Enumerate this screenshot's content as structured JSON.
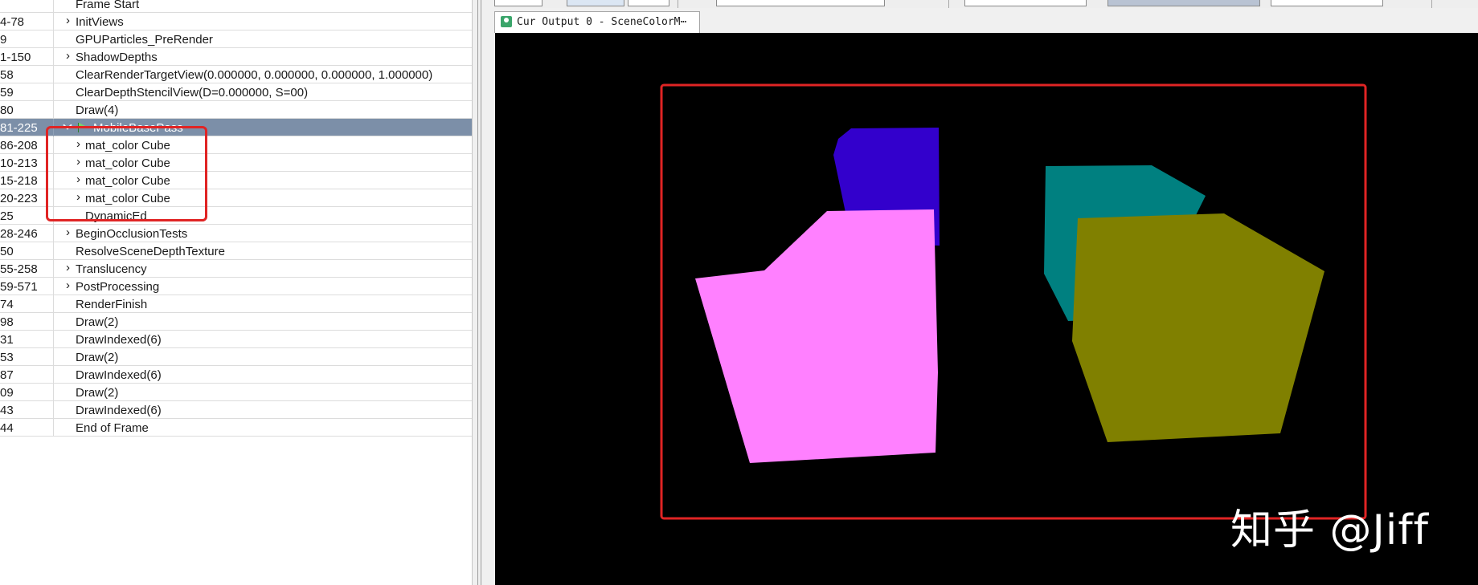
{
  "event_browser": {
    "rows": [
      {
        "eid": "",
        "name": "Frame Start",
        "expander": "none"
      },
      {
        "eid": "4-78",
        "name": "InitViews",
        "expander": "collapsed"
      },
      {
        "eid": "9",
        "name": "GPUParticles_PreRender",
        "expander": "none"
      },
      {
        "eid": "1-150",
        "name": "ShadowDepths",
        "expander": "collapsed"
      },
      {
        "eid": "58",
        "name": "ClearRenderTargetView(0.000000, 0.000000, 0.000000, 1.000000)",
        "expander": "none"
      },
      {
        "eid": "59",
        "name": "ClearDepthStencilView(D=0.000000, S=00)",
        "expander": "none"
      },
      {
        "eid": "80",
        "name": "Draw(4)",
        "expander": "none"
      },
      {
        "eid": "81-225",
        "name": "MobileBasePass",
        "expander": "expanded",
        "selected": true
      },
      {
        "eid": "86-208",
        "name": "mat_color Cube",
        "expander": "collapsed",
        "child": true
      },
      {
        "eid": "10-213",
        "name": "mat_color Cube",
        "expander": "collapsed",
        "child": true
      },
      {
        "eid": "15-218",
        "name": "mat_color Cube",
        "expander": "collapsed",
        "child": true
      },
      {
        "eid": "20-223",
        "name": "mat_color Cube",
        "expander": "collapsed",
        "child": true
      },
      {
        "eid": "25",
        "name": "DynamicEd",
        "expander": "none",
        "child": true
      },
      {
        "eid": "28-246",
        "name": "BeginOcclusionTests",
        "expander": "collapsed"
      },
      {
        "eid": "50",
        "name": "ResolveSceneDepthTexture",
        "expander": "none"
      },
      {
        "eid": "55-258",
        "name": "Translucency",
        "expander": "collapsed"
      },
      {
        "eid": "59-571",
        "name": "PostProcessing",
        "expander": "collapsed"
      },
      {
        "eid": "74",
        "name": "RenderFinish",
        "expander": "none"
      },
      {
        "eid": "98",
        "name": "Draw(2)",
        "expander": "none"
      },
      {
        "eid": "31",
        "name": "DrawIndexed(6)",
        "expander": "none"
      },
      {
        "eid": "53",
        "name": "Draw(2)",
        "expander": "none"
      },
      {
        "eid": "87",
        "name": "DrawIndexed(6)",
        "expander": "none"
      },
      {
        "eid": "09",
        "name": "Draw(2)",
        "expander": "none"
      },
      {
        "eid": "43",
        "name": "DrawIndexed(6)",
        "expander": "none"
      },
      {
        "eid": "44",
        "name": "End of Frame",
        "expander": "none"
      }
    ]
  },
  "texture_viewer": {
    "tab_label": "Cur Output 0 - SceneColorM⋯",
    "tab_icon": "texture-icon",
    "background_color": "#000000",
    "cubes": [
      {
        "name": "pink-cube",
        "color": "#ff80ff"
      },
      {
        "name": "blue-cube",
        "color": "#3300cc"
      },
      {
        "name": "teal-cube",
        "color": "#008080"
      },
      {
        "name": "olive-cube",
        "color": "#808000"
      }
    ],
    "watermark": "知乎 @Jiff"
  },
  "colors": {
    "selection": "#7c8fa8",
    "highlight": "#e02424"
  }
}
